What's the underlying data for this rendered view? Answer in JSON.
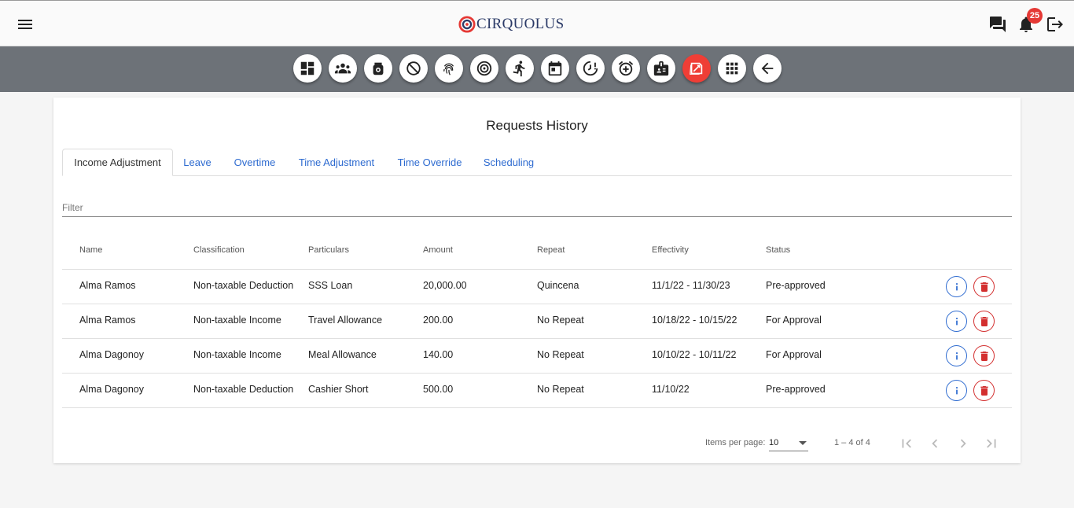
{
  "app": {
    "brand": "CIRQUOLUS",
    "notifications_count": "25"
  },
  "toolbar": {
    "items": [
      {
        "icon": "dashboard-icon"
      },
      {
        "icon": "employees-icon"
      },
      {
        "icon": "payroll-bag-icon"
      },
      {
        "icon": "no-timer-icon"
      },
      {
        "icon": "fingerprint-icon"
      },
      {
        "icon": "target-icon"
      },
      {
        "icon": "running-icon"
      },
      {
        "icon": "calendar-icon"
      },
      {
        "icon": "time-alert-icon"
      },
      {
        "icon": "alarm-add-icon"
      },
      {
        "icon": "id-badge-icon"
      },
      {
        "icon": "requests-icon",
        "active": true
      },
      {
        "icon": "apps-grid-icon"
      },
      {
        "icon": "back-arrow-icon"
      }
    ],
    "active_color": "#ef3e36"
  },
  "page": {
    "title": "Requests History"
  },
  "tabs": [
    {
      "label": "Income Adjustment",
      "active": true
    },
    {
      "label": "Leave"
    },
    {
      "label": "Overtime"
    },
    {
      "label": "Time Adjustment"
    },
    {
      "label": "Time Override"
    },
    {
      "label": "Scheduling"
    }
  ],
  "filter": {
    "placeholder": "Filter",
    "value": ""
  },
  "table": {
    "columns": [
      "Name",
      "Classification",
      "Particulars",
      "Amount",
      "Repeat",
      "Effectivity",
      "Status"
    ],
    "rows": [
      {
        "name": "Alma Ramos",
        "classification": "Non-taxable Deduction",
        "particulars": "SSS Loan",
        "amount": "20,000.00",
        "repeat": "Quincena",
        "effectivity": "11/1/22 - 11/30/23",
        "status": "Pre-approved"
      },
      {
        "name": "Alma Ramos",
        "classification": "Non-taxable Income",
        "particulars": "Travel Allowance",
        "amount": "200.00",
        "repeat": "No Repeat",
        "effectivity": "10/18/22 - 10/15/22",
        "status": "For Approval"
      },
      {
        "name": "Alma Dagonoy",
        "classification": "Non-taxable Income",
        "particulars": "Meal Allowance",
        "amount": "140.00",
        "repeat": "No Repeat",
        "effectivity": "10/10/22 - 10/11/22",
        "status": "For Approval"
      },
      {
        "name": "Alma Dagonoy",
        "classification": "Non-taxable Deduction",
        "particulars": "Cashier Short",
        "amount": "500.00",
        "repeat": "No Repeat",
        "effectivity": "11/10/22",
        "status": "Pre-approved"
      }
    ]
  },
  "paginator": {
    "items_per_page_label": "Items per page:",
    "items_per_page": "10",
    "range": "1 – 4 of 4"
  },
  "colors": {
    "link_blue": "#2e6bd0",
    "delete_red": "#d32f2f",
    "toolbar_bg": "#6d7278"
  }
}
